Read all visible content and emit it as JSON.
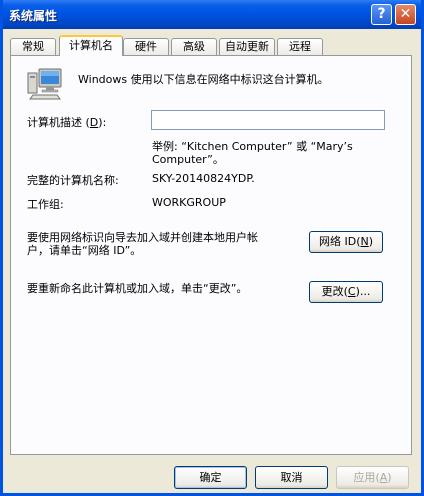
{
  "window": {
    "title": "系统属性"
  },
  "titlebar_buttons": {
    "help": "?",
    "close": "✕"
  },
  "tabs": [
    {
      "label": "常规",
      "active": false
    },
    {
      "label": "计算机名",
      "active": true
    },
    {
      "label": "硬件",
      "active": false
    },
    {
      "label": "高级",
      "active": false
    },
    {
      "label": "自动更新",
      "active": false
    },
    {
      "label": "远程",
      "active": false
    }
  ],
  "intro_text": "Windows 使用以下信息在网络中标识这台计算机。",
  "description": {
    "label": "计算机描述",
    "accel": "D",
    "value": "",
    "example_line1": "举例: “Kitchen Computer” 或 “Mary’s",
    "example_line2": "Computer”。"
  },
  "full_name": {
    "label": "完整的计算机名称:",
    "value": "SKY-20140824YDP."
  },
  "workgroup": {
    "label": "工作组:",
    "value": "WORKGROUP"
  },
  "network_id": {
    "text_line1": "要使用网络标识向导去加入域并创建本地用户帐",
    "text_line2": "户，请单击“网络 ID”。",
    "button_text": "网络 ID",
    "accel": "N"
  },
  "rename": {
    "text": "要重新命名此计算机或加入域，单击“更改”。",
    "button_text": "更改",
    "accel": "C",
    "button_suffix": "..."
  },
  "footer": {
    "ok": "确定",
    "cancel": "取消",
    "apply": "应用",
    "apply_accel": "A"
  }
}
